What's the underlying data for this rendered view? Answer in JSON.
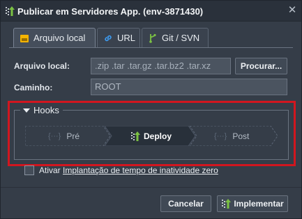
{
  "window": {
    "title": "Publicar em Servidores App. (env-3871430)",
    "close_glyph": "✕"
  },
  "tabs": [
    {
      "label": "Arquivo local",
      "icon": "folder-icon",
      "active": true
    },
    {
      "label": "URL",
      "icon": "link-icon",
      "active": false
    },
    {
      "label": "Git / SVN",
      "icon": "git-icon",
      "active": false
    }
  ],
  "form": {
    "local_file_label": "Arquivo local:",
    "local_file_placeholder": ".zip .tar .tar.gz .tar.bz2 .tar.xz",
    "browse_label": "Procurar...",
    "path_label": "Caminho:",
    "path_value": "ROOT"
  },
  "hooks": {
    "title": "Hooks",
    "steps": [
      {
        "label": "Pré",
        "prefix": "{···}",
        "active": false
      },
      {
        "label": "Deploy",
        "prefix": "",
        "active": true
      },
      {
        "label": "Post",
        "prefix": "{···}",
        "active": false
      }
    ]
  },
  "zero_downtime": {
    "prefix": "Ativar ",
    "link": "Implantação de tempo de inatividade zero",
    "checked": false
  },
  "footer": {
    "cancel_label": "Cancelar",
    "deploy_label": "Implementar"
  },
  "colors": {
    "accent_green": "#7bc143",
    "highlight_red": "#d2161f",
    "folder_yellow": "#f5b400",
    "link_blue": "#3d9bf0"
  }
}
